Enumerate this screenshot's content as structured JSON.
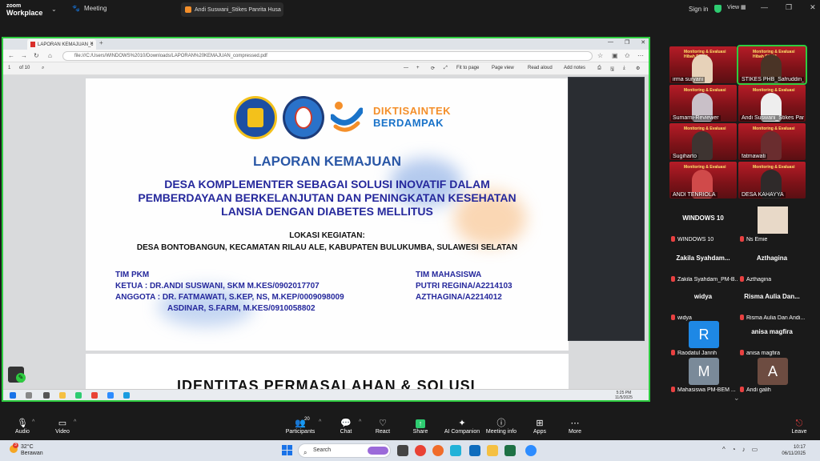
{
  "zoom": {
    "logo_line1": "zoom",
    "logo_line2": "Workplace",
    "meeting_tab": "Meeting",
    "share_tab": "Andi Suswani_Stikes Panrita Husa",
    "sign_in": "Sign in",
    "view": "View"
  },
  "browser": {
    "tab_title": "LAPORAN KEMAJUAN_c",
    "url": "file:///C:/Users/WINDOWS%2010/Downloads/LAPORAN%20KEMAJUAN_compressed.pdf",
    "page_num": "1",
    "page_total": "of 10",
    "fit_to_page": "Fit to page",
    "page_view": "Page view",
    "read_aloud": "Read aloud",
    "add_notes": "Add notes"
  },
  "slide": {
    "logo_text1": "DIKTISAINTEK",
    "logo_text2": "BERDAMPAK",
    "title": "LAPORAN KEMAJUAN",
    "subtitle_1": "DESA KOMPLEMENTER SEBAGAI SOLUSI INOVATIF DALAM",
    "subtitle_2": "PEMBERDAYAAN BERKELANJUTAN DAN PENINGKATAN KESEHATAN",
    "subtitle_3": "LANSIA DENGAN DIABETES MELLITUS",
    "lokasi_label": "LOKASI KEGIATAN:",
    "lokasi_value": "DESA BONTOBANGUN, KECAMATAN RILAU ALE, KABUPATEN BULUKUMBA, SULAWESI SELATAN",
    "tim_pkm": "TIM PKM",
    "ketua": "KETUA       : DR.ANDI SUSWANI, SKM  M.KES/0902017707",
    "anggota": "ANGGOTA : DR. FATMAWATI, S.KEP, NS, M.KEP/0009098009",
    "anggota_2": "ASDINAR, S.FARM, M.KES/0910058802",
    "tim_mahasiswa": "TIM MAHASISWA",
    "mhs_1": "PUTRI REGINA/A2214103",
    "mhs_2": "AZTHAGINA/A2214012",
    "next_page_title": "IDENTITAS  PERMASALAHAN  & SOLUSI"
  },
  "inner_clock": {
    "time": "5:25 PM",
    "date": "11/5/2025"
  },
  "participants": {
    "video": [
      {
        "name": "irma suryani"
      },
      {
        "name": "STIKES PHB_Safruddin_K..."
      },
      {
        "name": "Sumarni-Reviewer"
      },
      {
        "name": "Andi Suswani_Stikes Panr..."
      },
      {
        "name": "Sugiharto"
      },
      {
        "name": "fatmawati"
      },
      {
        "name": "ANDI TENRIOLA"
      },
      {
        "name": "DESA KAHAYYA"
      }
    ],
    "tiles": [
      {
        "big": "WINDOWS 10",
        "name": "WINDOWS 10"
      },
      {
        "big": "",
        "name": "Ns Emie"
      },
      {
        "big": "Zakila  Syahdam...",
        "name": "Zakila  Syahdam_PM-B..."
      },
      {
        "big": "Azthagina",
        "name": "Azthagina"
      },
      {
        "big": "widya",
        "name": "widya"
      },
      {
        "big": "Risma Aulia Dan...",
        "name": "Risma Aulia Dan Andi..."
      },
      {
        "avatar": "R",
        "name": "Raodatul Jannh"
      },
      {
        "big": "anisa magfira",
        "name": "anisa magfira"
      },
      {
        "avatar": "M",
        "name": "Mahasiswa PM-BEM ..."
      },
      {
        "avatar": "A",
        "name": "Andi galih"
      }
    ]
  },
  "controls": {
    "audio": "Audio",
    "video": "Video",
    "participants": "Participants",
    "participants_count": "20",
    "chat": "Chat",
    "react": "React",
    "share": "Share",
    "ai_companion": "AI Companion",
    "meeting_info": "Meeting info",
    "apps": "Apps",
    "more": "More",
    "leave": "Leave"
  },
  "taskbar": {
    "weather_temp": "32°C",
    "weather_desc": "Berawan",
    "weather_badge": "3",
    "search_placeholder": "Search",
    "time": "10:17",
    "date": "06/11/2025"
  },
  "colors": {
    "accent_green": "#2ecc40",
    "slide_title_blue": "#2a57a6",
    "slide_text_navy": "#25289c",
    "dikti_orange": "#f48f2a",
    "dikti_blue": "#1a73c9",
    "leave_red": "#e84141"
  }
}
